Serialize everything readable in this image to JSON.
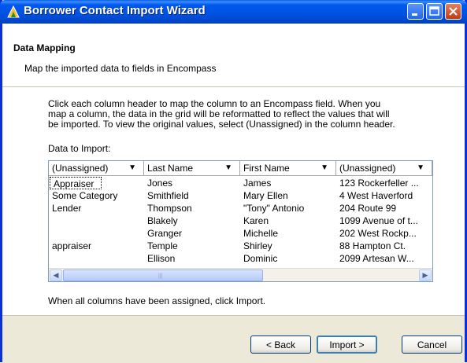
{
  "window": {
    "title": "Borrower Contact Import Wizard",
    "accent_color": "#0054e3",
    "title_icon": "encompass-app-icon"
  },
  "header": {
    "title": "Data Mapping",
    "subtitle": "Map the imported data to fields in Encompass"
  },
  "instructions": {
    "line1": "Click each column header to map the column to an Encompass field. When you",
    "line2": "map a column, the data in the grid will be reformatted to reflect the values that will",
    "line3": "be imported. To view the original values, select (Unassigned) in the column header."
  },
  "grid": {
    "label": "Data to Import:",
    "columns": [
      "(Unassigned)",
      "Last Name",
      "First Name",
      "(Unassigned)"
    ],
    "rows": [
      [
        "Appraiser",
        "Jones",
        "James",
        "123 Rockerfeller ..."
      ],
      [
        "Some Category",
        "Smithfield",
        "Mary Ellen",
        "4 West Haverford"
      ],
      [
        "Lender",
        "Thompson",
        "\"Tony\" Antonio",
        "204 Route 99"
      ],
      [
        "",
        "Blakely",
        "Karen",
        "1099 Avenue of t..."
      ],
      [
        "",
        "Granger",
        "Michelle",
        "202 West Rockp..."
      ],
      [
        "appraiser",
        "Temple",
        "Shirley",
        "88 Hampton Ct."
      ],
      [
        "",
        "Ellison",
        "Dominic",
        "2099 Artesan W..."
      ]
    ],
    "scroll_position": 0
  },
  "footer_text": "When all columns have been assigned, click Import.",
  "buttons": {
    "back": "< Back",
    "import": "Import >",
    "cancel": "Cancel"
  }
}
